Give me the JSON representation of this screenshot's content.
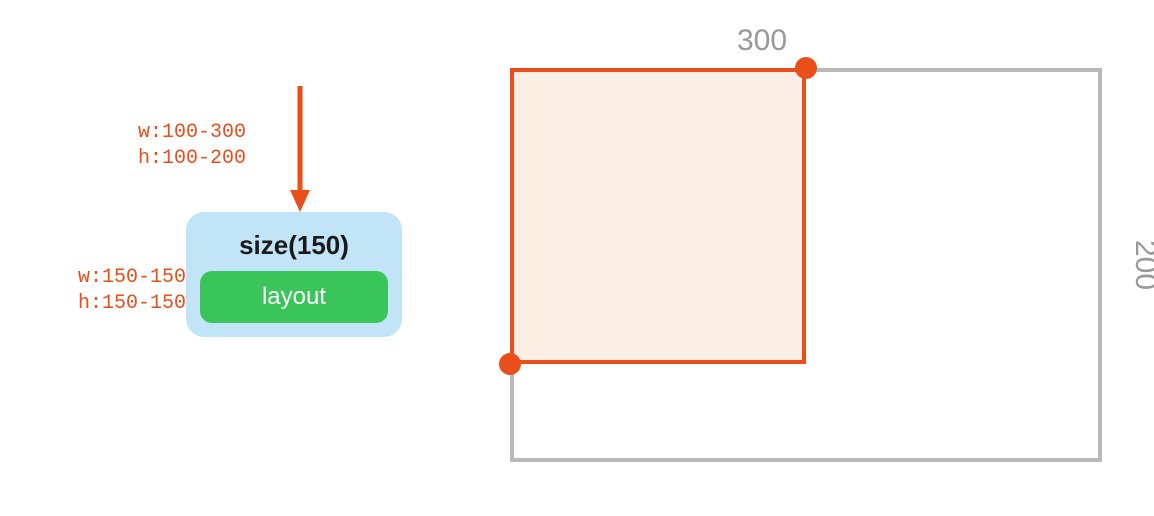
{
  "constraints": {
    "incoming": {
      "w": "w:100-300",
      "h": "h:100-200"
    },
    "outgoing": {
      "w": "w:150-150",
      "h": "h:150-150"
    }
  },
  "node": {
    "title": "size(150)",
    "child": "layout"
  },
  "box_labels": {
    "top": "300",
    "right": "200"
  },
  "colors": {
    "accent": "#ea4e1a",
    "node_bg": "#c1e4f6",
    "pill_bg": "#39c559",
    "outer_border": "#b9b9b9",
    "inner_fill": "#fdeee5"
  }
}
